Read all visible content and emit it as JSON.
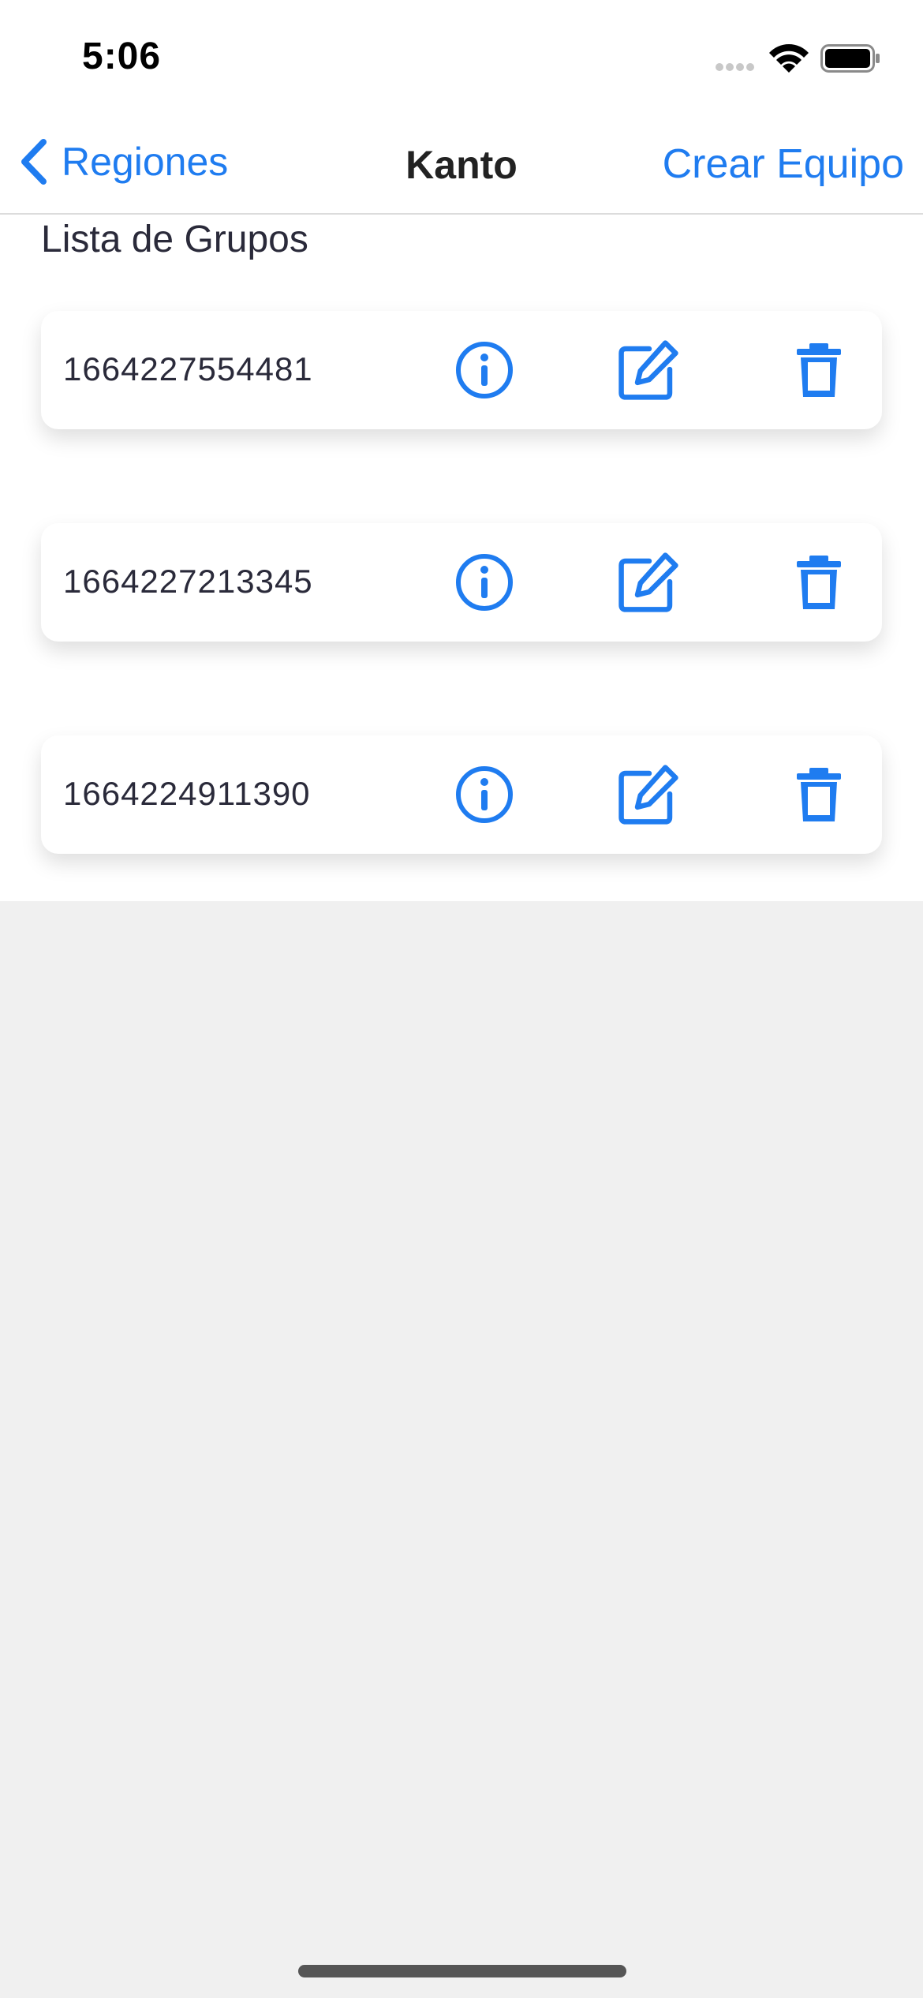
{
  "status_bar": {
    "time": "5:06"
  },
  "nav": {
    "back_label": "Regiones",
    "title": "Kanto",
    "action_label": "Crear Equipo"
  },
  "section_title": "Lista de Grupos",
  "groups": [
    {
      "id": "1664227554481"
    },
    {
      "id": "1664227213345"
    },
    {
      "id": "1664224911390"
    }
  ],
  "colors": {
    "accent": "#1f7cf0",
    "background": "#f0f0f0",
    "surface": "#ffffff",
    "text": "#2a2a3a"
  },
  "icons": {
    "info": "info-circle-icon",
    "edit": "edit-square-icon",
    "delete": "trash-icon"
  }
}
